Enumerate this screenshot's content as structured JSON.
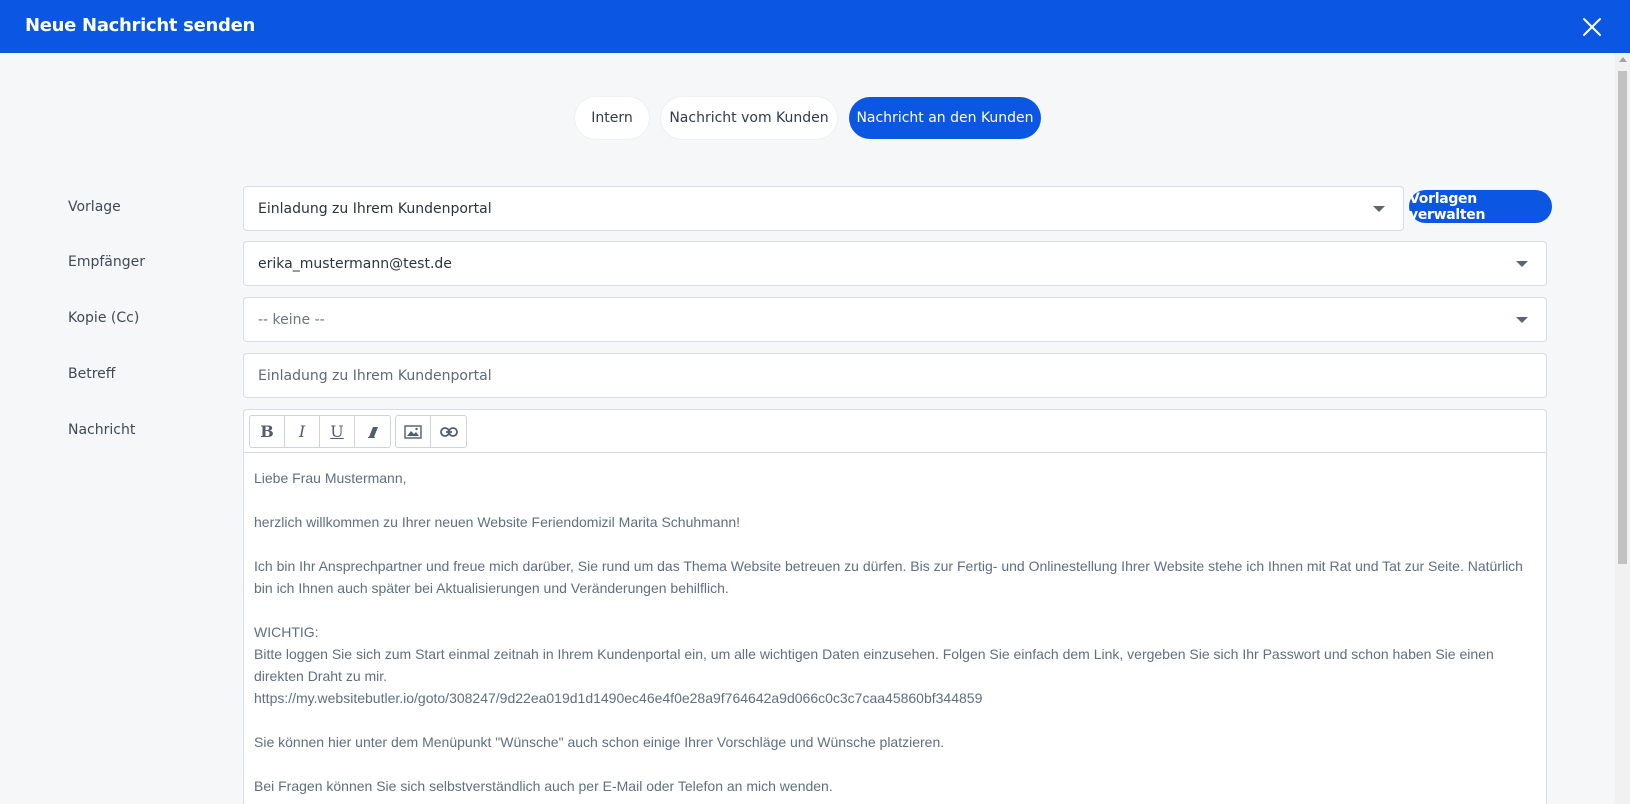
{
  "header": {
    "title": "Neue Nachricht senden"
  },
  "tabs": [
    {
      "label": "Intern",
      "active": false
    },
    {
      "label": "Nachricht vom Kunden",
      "active": false
    },
    {
      "label": "Nachricht an den Kunden",
      "active": true
    }
  ],
  "form": {
    "template_label": "Vorlage",
    "template_value": "Einladung zu Ihrem Kundenportal",
    "manage_templates_label": "Vorlagen verwalten",
    "recipient_label": "Empfänger",
    "recipient_value": "erika_mustermann@test.de",
    "cc_label": "Kopie (Cc)",
    "cc_value": "-- keine --",
    "subject_label": "Betreff",
    "subject_value": "Einladung zu Ihrem Kundenportal",
    "message_label": "Nachricht"
  },
  "toolbar": {
    "bold": "B",
    "italic": "I",
    "underline": "U"
  },
  "message": {
    "greeting": "Liebe Frau Mustermann,",
    "welcome": "herzlich willkommen zu Ihrer neuen Website Feriendomizil Marita Schuhmann!",
    "intro_line1": "Ich bin Ihr Ansprechpartner und freue mich darüber, Sie rund um das Thema Website betreuen zu dürfen. Bis zur Fertig- und Onlinestellung Ihrer Website stehe ich Ihnen mit Rat und Tat zur Seite. Natürlich",
    "intro_line2": "bin ich Ihnen auch später bei Aktualisierungen und Veränderungen behilflich.",
    "important": "WICHTIG:",
    "login_line1": "Bitte loggen Sie sich zum Start einmal zeitnah in Ihrem Kundenportal ein, um alle wichtigen Daten einzusehen. Folgen Sie einfach dem Link, vergeben Sie sich Ihr Passwort und schon haben Sie einen",
    "login_line2": "direkten Draht zu mir.",
    "link": "https://my.websitebutler.io/goto/308247/9d22ea019d1d1490ec46e4f0e28a9f764642a9d066c0c3c7caa45860bf344859",
    "wishes": "Sie können hier unter dem Menüpunkt \"Wünsche\" auch schon einige Ihrer Vorschläge und Wünsche platzieren.",
    "questions": "Bei Fragen können Sie sich selbstverständlich auch per E-Mail oder Telefon an mich wenden."
  },
  "colors": {
    "primary": "#0b57e3",
    "background": "#f6f7f9"
  }
}
